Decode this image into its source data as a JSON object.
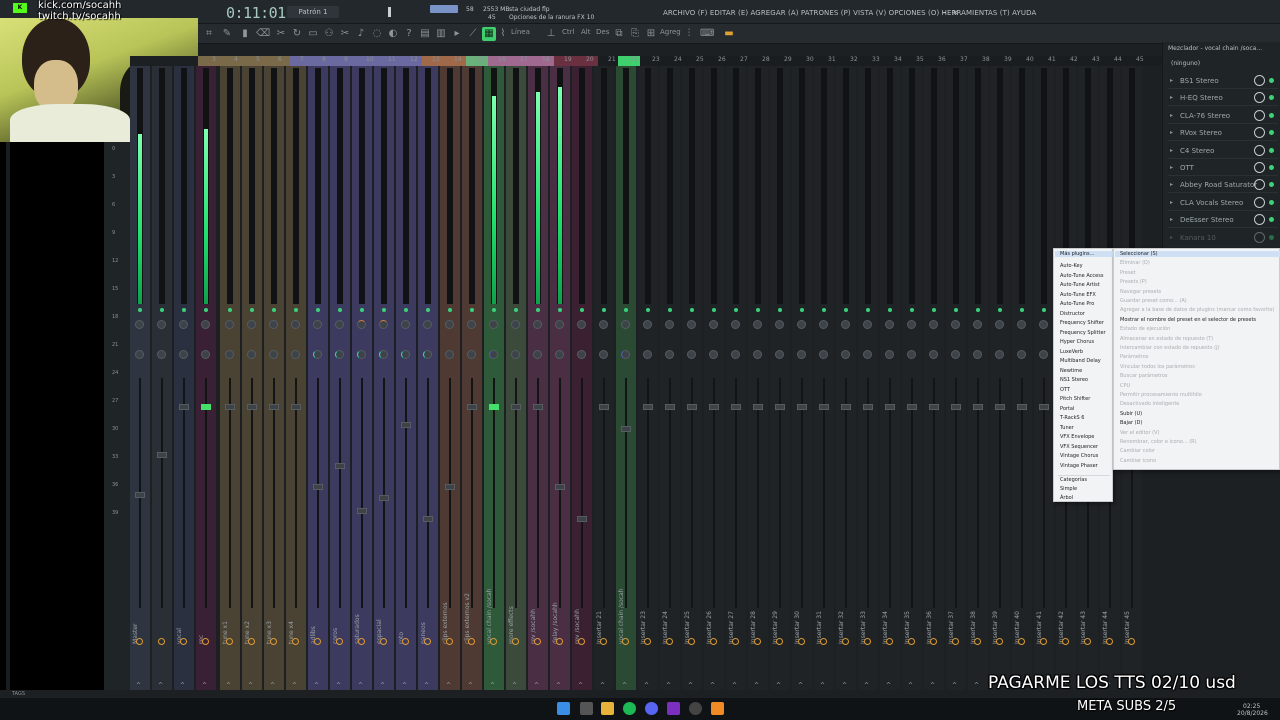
{
  "overlay": {
    "kick": "kick.com/socahh",
    "twitch": "twitch.tv/socahh",
    "tts": "PAGARME LOS TTS 02/10 usd",
    "subs": "META SUBS 2/5"
  },
  "topbar": {
    "time": "0:11:01",
    "pattern": "Patrón 1",
    "cpu": "58",
    "ram": "2553 MB",
    "voices": "45",
    "project": "sta ciudad flp",
    "hint": "Opciones de la ranura FX 10",
    "menu": "ARCHIVO (F)  EDITAR (E)  AGREGAR (A)  PATRONES (P)  VISTA (V)  OPCIONES (O)  HERRAMIENTAS (T)  AYUDA"
  },
  "toolbar": {
    "line_mode": "Línea",
    "ctrl": "Ctrl",
    "alt": "Alt",
    "des": "Des",
    "agreg": "Agreg"
  },
  "db_scale": [
    "0",
    "3",
    "6",
    "9",
    "12",
    "15",
    "18",
    "21",
    "24",
    "27",
    "30",
    "33",
    "36",
    "39"
  ],
  "ruler": [
    "M",
    "1",
    "2",
    "3",
    "4",
    "5",
    "6",
    "7",
    "8",
    "9",
    "10",
    "11",
    "12",
    "13",
    "14",
    "15",
    "16",
    "17",
    "18",
    "19",
    "20",
    "21",
    "22",
    "23",
    "24",
    "25",
    "26",
    "27",
    "28",
    "29",
    "30",
    "31",
    "32",
    "33",
    "34",
    "35",
    "36",
    "37",
    "38",
    "39",
    "40",
    "41",
    "42",
    "43",
    "44",
    "45"
  ],
  "tracks": [
    {
      "name": "Master",
      "meter": 0.72,
      "color": "#2f3540"
    },
    {
      "name": "",
      "meter": 0.0,
      "color": "#2a2e35"
    },
    {
      "name": "vocal",
      "meter": 0.0,
      "color": "#2b3040"
    },
    {
      "name": "rec",
      "meter": 0.74,
      "color": "#3a2034"
    },
    {
      "name": "tune x1",
      "meter": 0.0,
      "color": "#4a4232"
    },
    {
      "name": "tune x2",
      "meter": 0.0,
      "color": "#4a4232"
    },
    {
      "name": "tune x3",
      "meter": 0.0,
      "color": "#4a4232"
    },
    {
      "name": "tune x4",
      "meter": 0.0,
      "color": "#4a4232"
    },
    {
      "name": "adlibs",
      "meter": 0.0,
      "color": "#3c3a5e"
    },
    {
      "name": "coros",
      "meter": 0.0,
      "color": "#3c3a5e"
    },
    {
      "name": "saturados",
      "meter": 0.0,
      "color": "#3c3a5e"
    },
    {
      "name": "espacial",
      "meter": 0.0,
      "color": "#3c3a5e"
    },
    {
      "name": "roto",
      "meter": 0.0,
      "color": "#3c3a5e"
    },
    {
      "name": "paneos",
      "meter": 0.0,
      "color": "#3c3a5e"
    },
    {
      "name": "clips externos",
      "meter": 0.0,
      "color": "#4e3a32"
    },
    {
      "name": "clips externos v2",
      "meter": 0.0,
      "color": "#4e3a32"
    },
    {
      "name": "vocal chain /socah",
      "meter": 0.88,
      "color": "#2f5a3a"
    },
    {
      "name": "more effects",
      "meter": 0.0,
      "color": "#3b4a3a"
    },
    {
      "name": "rev /socahh",
      "meter": 0.9,
      "color": "#4a2e44"
    },
    {
      "name": "delay /socahh",
      "meter": 0.92,
      "color": "#4a2e44"
    },
    {
      "name": "rev /socahh",
      "meter": 0.0,
      "color": "#3a2030"
    },
    {
      "name": "Insertar 21",
      "meter": 0.0,
      "color": "#1f2326"
    },
    {
      "name": "vocal chain /socah",
      "meter": 0.0,
      "color": "#2b4a33"
    },
    {
      "name": "Insertar 23",
      "meter": 0.0,
      "color": "#1f2326"
    },
    {
      "name": "Insertar 24",
      "meter": 0.0,
      "color": "#1f2326"
    },
    {
      "name": "Insertar 25",
      "meter": 0.0,
      "color": "#1f2326"
    },
    {
      "name": "Insertar 26",
      "meter": 0.0,
      "color": "#1f2326"
    },
    {
      "name": "Insertar 27",
      "meter": 0.0,
      "color": "#1f2326"
    },
    {
      "name": "Insertar 28",
      "meter": 0.0,
      "color": "#1f2326"
    },
    {
      "name": "Insertar 29",
      "meter": 0.0,
      "color": "#1f2326"
    },
    {
      "name": "Insertar 30",
      "meter": 0.0,
      "color": "#1f2326"
    },
    {
      "name": "Insertar 31",
      "meter": 0.0,
      "color": "#1f2326"
    },
    {
      "name": "Insertar 32",
      "meter": 0.0,
      "color": "#1f2326"
    },
    {
      "name": "Insertar 33",
      "meter": 0.0,
      "color": "#1f2326"
    },
    {
      "name": "Insertar 34",
      "meter": 0.0,
      "color": "#1f2326"
    },
    {
      "name": "Insertar 35",
      "meter": 0.0,
      "color": "#1f2326"
    },
    {
      "name": "Insertar 36",
      "meter": 0.0,
      "color": "#1f2326"
    },
    {
      "name": "Insertar 37",
      "meter": 0.0,
      "color": "#1f2326"
    },
    {
      "name": "Insertar 38",
      "meter": 0.0,
      "color": "#1f2326"
    },
    {
      "name": "Insertar 39",
      "meter": 0.0,
      "color": "#1f2326"
    },
    {
      "name": "Insertar 40",
      "meter": 0.0,
      "color": "#1f2326"
    },
    {
      "name": "Insertar 41",
      "meter": 0.0,
      "color": "#1f2326"
    },
    {
      "name": "Insertar 42",
      "meter": 0.0,
      "color": "#1f2326"
    },
    {
      "name": "Insertar 43",
      "meter": 0.0,
      "color": "#1f2326"
    },
    {
      "name": "Insertar 44",
      "meter": 0.0,
      "color": "#1f2326"
    },
    {
      "name": "Insertar 45",
      "meter": 0.0,
      "color": "#1f2326"
    },
    {
      "name": "Insertar 46",
      "meter": 0.0,
      "color": "#1f2326"
    }
  ],
  "fx_panel": {
    "title": "Mezclador - vocal chain /soca...",
    "preset": "(ninguno)",
    "slots": [
      "BS1 Stereo",
      "H-EQ Stereo",
      "CLA-76 Stereo",
      "RVox Stereo",
      "C4 Stereo",
      "OTT",
      "Abbey Road Saturator",
      "CLA Vocals Stereo",
      "DeEsser Stereo",
      "Kanara 10"
    ]
  },
  "plugin_menu": {
    "header": "Más plugins...",
    "items": [
      "Auto-Key",
      "Auto-Tune Access",
      "Auto-Tune Artist",
      "Auto-Tune EFX",
      "Auto-Tune Pro",
      "Distructor",
      "Frequency Shifter",
      "Frequency Splitter",
      "Hyper Chorus",
      "LuxeVerb",
      "Multiband Delay",
      "Newtime",
      "NS1 Stereo",
      "OTT",
      "Pitch Shifter",
      "Portal",
      "T-RackS 6",
      "Tuner",
      "VFX Envelope",
      "VFX Sequencer",
      "Vintage Chorus",
      "Vintage Phaser"
    ],
    "footer": [
      "Categorías",
      "Simple",
      "Árbol"
    ]
  },
  "slot_menu": {
    "items": [
      {
        "label": "Seleccionar (S)",
        "enabled": true
      },
      {
        "label": "Eliminar (D)",
        "enabled": false
      },
      {
        "label": "Preset",
        "enabled": false
      },
      {
        "label": "Presets (P)",
        "enabled": false
      },
      {
        "label": "Navegar presets",
        "enabled": false
      },
      {
        "label": "Guardar preset como... (A)",
        "enabled": false
      },
      {
        "label": "Agregar a la base de datos de plugins (marcar como favorito)",
        "enabled": false
      },
      {
        "label": "Mostrar el nombre del preset en el selector de presets",
        "enabled": true
      },
      {
        "label": "Estado de ejecución",
        "enabled": false
      },
      {
        "label": "Almacenar en estado de repuesto (T)",
        "enabled": false
      },
      {
        "label": "Intercambiar con estado de repuesto (J)",
        "enabled": false
      },
      {
        "label": "Parámetros",
        "enabled": false
      },
      {
        "label": "Vincular todos los parámetros",
        "enabled": false
      },
      {
        "label": "Buscar parámetros",
        "enabled": false
      },
      {
        "label": "CPU",
        "enabled": false
      },
      {
        "label": "Permitir procesamiento multihilo",
        "enabled": false
      },
      {
        "label": "Desactivado inteligente",
        "enabled": false
      },
      {
        "label": "Subir (U)",
        "enabled": true
      },
      {
        "label": "Bajar (D)",
        "enabled": true
      },
      {
        "label": "Ver el editor (V)",
        "enabled": false
      },
      {
        "label": "Renombrar, color e icono... (R)",
        "enabled": false
      },
      {
        "label": "Cambiar color",
        "enabled": false
      },
      {
        "label": "Cambiar icono",
        "enabled": false
      }
    ]
  },
  "bottom": {
    "label": "TAGS"
  },
  "tray": {
    "time": "02:25",
    "date": "20/8/2026"
  }
}
